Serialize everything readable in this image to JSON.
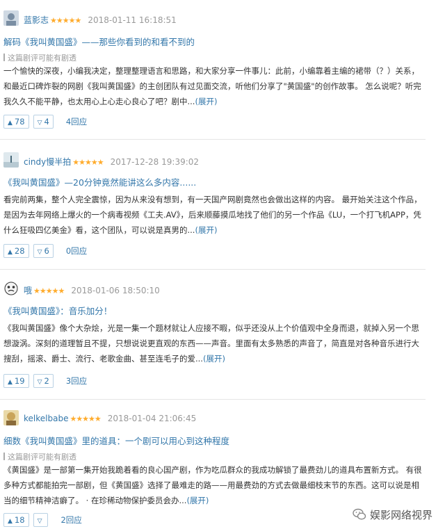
{
  "reviews": [
    {
      "user": "蓝影志",
      "stars": "★★★★★",
      "time": "2018-01-11 16:18:51",
      "title": "解码《我叫黄国盛》——那些你看到的和看不到的",
      "spoiler": "这篇剧评可能有剧透",
      "body": "一个愉快的深夜，小编我决定，整理整理语言和思路，和大家分享一件事儿：此前，小编靠着主编的裙带（？）关系，和最近口碑炸裂的网剧《我叫黄国盛》的主创团队有过见面交流，听他们分享了\"黄国盛\"的创作故事。 怎么说呢？听完我久久不能平静，也太用心上心走心良心了吧？剧中...",
      "expand": "(展开)",
      "up": "78",
      "down": "4",
      "replies": "4回应"
    },
    {
      "user": "cindy慢半拍",
      "stars": "★★★★★",
      "time": "2017-12-28 19:39:02",
      "title": "《我叫黄国盛》—20分钟竟然能讲这么多内容......",
      "spoiler": "",
      "body": "看完前两集，整个人完全震惊，因为从来没有想到，有一天国产网剧竟然也会做出这样的内容。 最开始关注这个作品，是因为去年网络上爆火的一个病毒视频《工夫.AV》，后来顺藤摸瓜地找了他们的另一个作品《LU，一个打飞机APP，凭什么狂吸四亿美金》看，这个团队，可以说是真男的...",
      "expand": "(展开)",
      "up": "28",
      "down": "6",
      "replies": "0回应"
    },
    {
      "user": "哦",
      "stars": "★★★★★",
      "time": "2018-01-06 18:50:10",
      "title": "《我叫黄国盛》：音乐加分！",
      "spoiler": "",
      "body": "《我叫黄国盛》像个大杂烩，光是一集一个题材就让人应接不暇，似乎还没从上个价值观中全身而退，就掉入另一个思想漩涡。深刻的道理暂且不提，只想说说更直观的东西——声音。里面有太多熟悉的声音了，简直是对各种音乐进行大搜刮，摇滚、爵士、流行、老歌金曲、甚至连毛子的爱...",
      "expand": "(展开)",
      "up": "19",
      "down": "2",
      "replies": "3回应"
    },
    {
      "user": "kelkelbabe",
      "stars": "★★★★★",
      "time": "2018-01-04 21:06:45",
      "title": "细数《我叫黄国盛》里的道具：一个剧可以用心到这种程度",
      "spoiler": "这篇剧评可能有剧透",
      "body": "《黄国盛》是一部第一集开始我跪着看的良心国产剧，作为吃瓜群众的我成功解锁了最费劲儿的道具布置新方式。 有很多种方式都能拍完一部剧，但《黄国盛》选择了最难走的路——用最费劲的方式去做最细枝末节的东西。这可以说是相当的细节精神洁癖了。 · 在珍稀动物保护委员会办...",
      "expand": "(展开)",
      "up": "18",
      "down": "",
      "replies": "2回应"
    }
  ],
  "icons": {
    "up": "▲",
    "down": "▽"
  },
  "watermark": "娱影网络视界",
  "colors": {
    "link": "#3377aa",
    "star": "#ffac2d",
    "muted": "#999999"
  }
}
